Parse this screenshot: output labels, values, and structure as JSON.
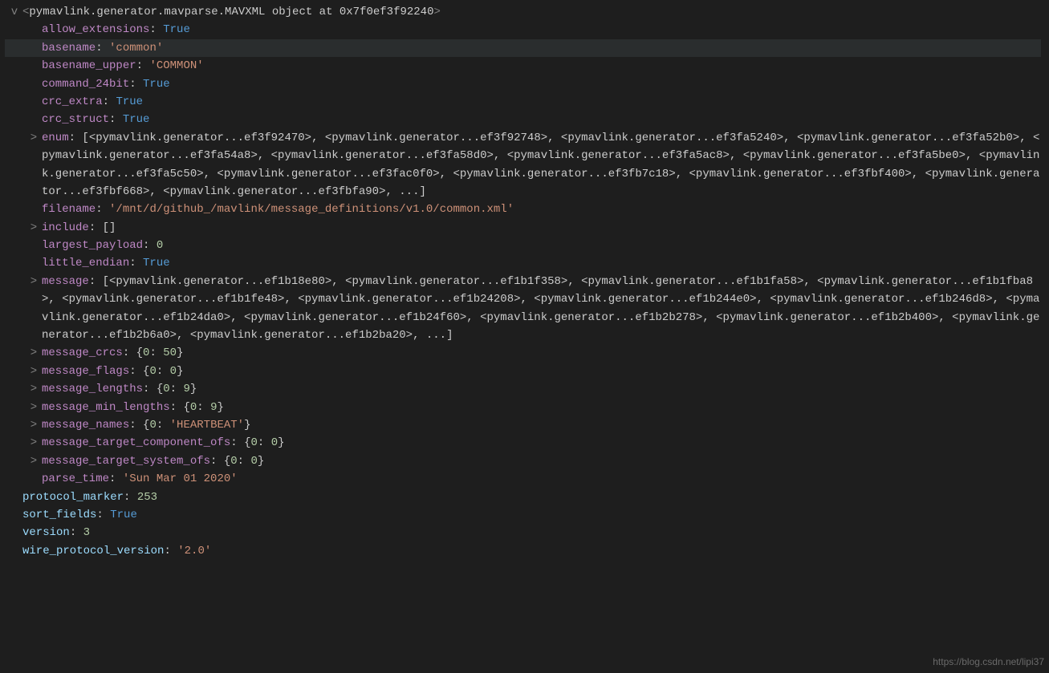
{
  "header": {
    "twist": "v",
    "bracket_open": "<",
    "object_repr": "pymavlink.generator.mavparse.MAVXML object at 0x7f0ef3f92240",
    "bracket_close": ">"
  },
  "rows": [
    {
      "key": "allow_extensions",
      "sep": ": ",
      "val": "True",
      "vtype": "bool",
      "highlight": false,
      "twist": "",
      "indent": 1
    },
    {
      "key": "basename",
      "sep": ": ",
      "val": "'common'",
      "vtype": "str",
      "highlight": true,
      "twist": "",
      "indent": 1
    },
    {
      "key": "basename_upper",
      "sep": ": ",
      "val": "'COMMON'",
      "vtype": "str",
      "highlight": false,
      "twist": "",
      "indent": 1
    },
    {
      "key": "command_24bit",
      "sep": ": ",
      "val": "True",
      "vtype": "bool",
      "highlight": false,
      "twist": "",
      "indent": 1
    },
    {
      "key": "crc_extra",
      "sep": ": ",
      "val": "True",
      "vtype": "bool",
      "highlight": false,
      "twist": "",
      "indent": 1
    },
    {
      "key": "crc_struct",
      "sep": ": ",
      "val": "True",
      "vtype": "bool",
      "highlight": false,
      "twist": "",
      "indent": 1
    }
  ],
  "enum": {
    "key": "enum",
    "sep": ": ",
    "text": "[<pymavlink.generator...ef3f92470>, <pymavlink.generator...ef3f92748>, <pymavlink.generator...ef3fa5240>, <pymavlink.generator...ef3fa52b0>, <pymavlink.generator...ef3fa54a8>, <pymavlink.generator...ef3fa58d0>, <pymavlink.generator...ef3fa5ac8>, <pymavlink.generator...ef3fa5be0>, <pymavlink.generator...ef3fa5c50>, <pymavlink.generator...ef3fac0f0>, <pymavlink.generator...ef3fb7c18>, <pymavlink.generator...ef3fbf400>, <pymavlink.generator...ef3fbf668>, <pymavlink.generator...ef3fbfa90>, ...]",
    "twist": ">"
  },
  "filename": {
    "key": "filename",
    "sep": ": ",
    "val": "'/mnt/d/github_/mavlink/message_definitions/v1.0/common.xml'"
  },
  "include": {
    "key": "include",
    "sep": ": ",
    "val": "[]",
    "twist": ">"
  },
  "largest_payload": {
    "key": "largest_payload",
    "sep": ": ",
    "val": "0"
  },
  "little_endian": {
    "key": "little_endian",
    "sep": ": ",
    "val": "True"
  },
  "message": {
    "key": "message",
    "sep": ": ",
    "text": "[<pymavlink.generator...ef1b18e80>, <pymavlink.generator...ef1b1f358>, <pymavlink.generator...ef1b1fa58>, <pymavlink.generator...ef1b1fba8>, <pymavlink.generator...ef1b1fe48>, <pymavlink.generator...ef1b24208>, <pymavlink.generator...ef1b244e0>, <pymavlink.generator...ef1b246d8>, <pymavlink.generator...ef1b24da0>, <pymavlink.generator...ef1b24f60>, <pymavlink.generator...ef1b2b278>, <pymavlink.generator...ef1b2b400>, <pymavlink.generator...ef1b2b6a0>, <pymavlink.generator...ef1b2ba20>, ...]",
    "twist": ">"
  },
  "post_message": [
    {
      "key": "message_crcs",
      "sep": ": ",
      "pre": "{",
      "k0": "0",
      "mid": ": ",
      "v0": "50",
      "post": "}",
      "twist": ">"
    },
    {
      "key": "message_flags",
      "sep": ": ",
      "pre": "{",
      "k0": "0",
      "mid": ": ",
      "v0": "0",
      "post": "}",
      "twist": ">"
    },
    {
      "key": "message_lengths",
      "sep": ": ",
      "pre": "{",
      "k0": "0",
      "mid": ": ",
      "v0": "9",
      "post": "}",
      "twist": ">"
    },
    {
      "key": "message_min_lengths",
      "sep": ": ",
      "pre": "{",
      "k0": "0",
      "mid": ": ",
      "v0": "9",
      "post": "}",
      "twist": ">"
    }
  ],
  "message_names": {
    "key": "message_names",
    "sep": ": ",
    "pre": "{",
    "k0": "0",
    "mid": ": ",
    "v0": "'HEARTBEAT'",
    "post": "}",
    "twist": ">"
  },
  "post_names": [
    {
      "key": "message_target_component_ofs",
      "sep": ": ",
      "pre": "{",
      "k0": "0",
      "mid": ": ",
      "v0": "0",
      "post": "}",
      "twist": ">"
    },
    {
      "key": "message_target_system_ofs",
      "sep": ": ",
      "pre": "{",
      "k0": "0",
      "mid": ": ",
      "v0": "0",
      "post": "}",
      "twist": ">"
    }
  ],
  "parse_time": {
    "key": "parse_time",
    "sep": ": ",
    "val": "'Sun Mar 01 2020'"
  },
  "tail": [
    {
      "key": "protocol_marker",
      "sep": ": ",
      "val": "253",
      "vtype": "num"
    },
    {
      "key": "sort_fields",
      "sep": ": ",
      "val": "True",
      "vtype": "bool"
    },
    {
      "key": "version",
      "sep": ": ",
      "val": "3",
      "vtype": "num"
    },
    {
      "key": "wire_protocol_version",
      "sep": ": ",
      "val": "'2.0'",
      "vtype": "str"
    }
  ],
  "watermark": "https://blog.csdn.net/lipi37"
}
